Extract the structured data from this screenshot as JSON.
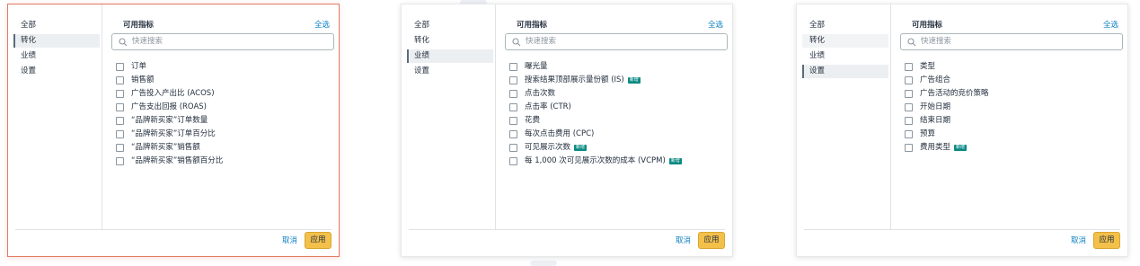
{
  "panels": [
    {
      "sidebar": [
        "全部",
        "转化",
        "业绩",
        "设置"
      ],
      "header_title": "可用指标",
      "select_all": "全选",
      "search_placeholder": "快速搜索",
      "items": [
        {
          "label": "订单"
        },
        {
          "label": "销售额"
        },
        {
          "label": "广告投入产出比 (ACOS)"
        },
        {
          "label": "广告支出回报 (ROAS)"
        },
        {
          "label": "“品牌新买家”订单数量"
        },
        {
          "label": "“品牌新买家”订单百分比"
        },
        {
          "label": "“品牌新买家”销售额"
        },
        {
          "label": "“品牌新买家”销售额百分比"
        }
      ],
      "cancel": "取消",
      "apply": "应用"
    },
    {
      "sidebar": [
        "全部",
        "转化",
        "业绩",
        "设置"
      ],
      "header_title": "可用指标",
      "select_all": "全选",
      "search_placeholder": "快速搜索",
      "items": [
        {
          "label": "曝光量"
        },
        {
          "label": "搜索结果顶部展示量份额 (IS)",
          "badge": "新增"
        },
        {
          "label": "点击次数"
        },
        {
          "label": "点击率 (CTR)"
        },
        {
          "label": "花费"
        },
        {
          "label": "每次点击费用 (CPC)"
        },
        {
          "label": "可见展示次数",
          "badge": "新增"
        },
        {
          "label": "每 1,000 次可见展示次数的成本 (VCPM)",
          "badge": "新增"
        }
      ],
      "cancel": "取消",
      "apply": "应用"
    },
    {
      "sidebar": [
        "全部",
        "转化",
        "业绩",
        "设置"
      ],
      "header_title": "可用指标",
      "select_all": "全选",
      "search_placeholder": "快速搜索",
      "items": [
        {
          "label": "类型"
        },
        {
          "label": "广告组合"
        },
        {
          "label": "广告活动的竞价策略"
        },
        {
          "label": "开始日期"
        },
        {
          "label": "结束日期"
        },
        {
          "label": "预算"
        },
        {
          "label": "费用类型",
          "badge": "新增"
        }
      ],
      "cancel": "取消",
      "apply": "应用"
    }
  ],
  "colors": {
    "link": "#0a7fc2",
    "apply_button": "#f3c04a",
    "new_badge": "#0c8a84",
    "active_border": "#e07b62"
  }
}
